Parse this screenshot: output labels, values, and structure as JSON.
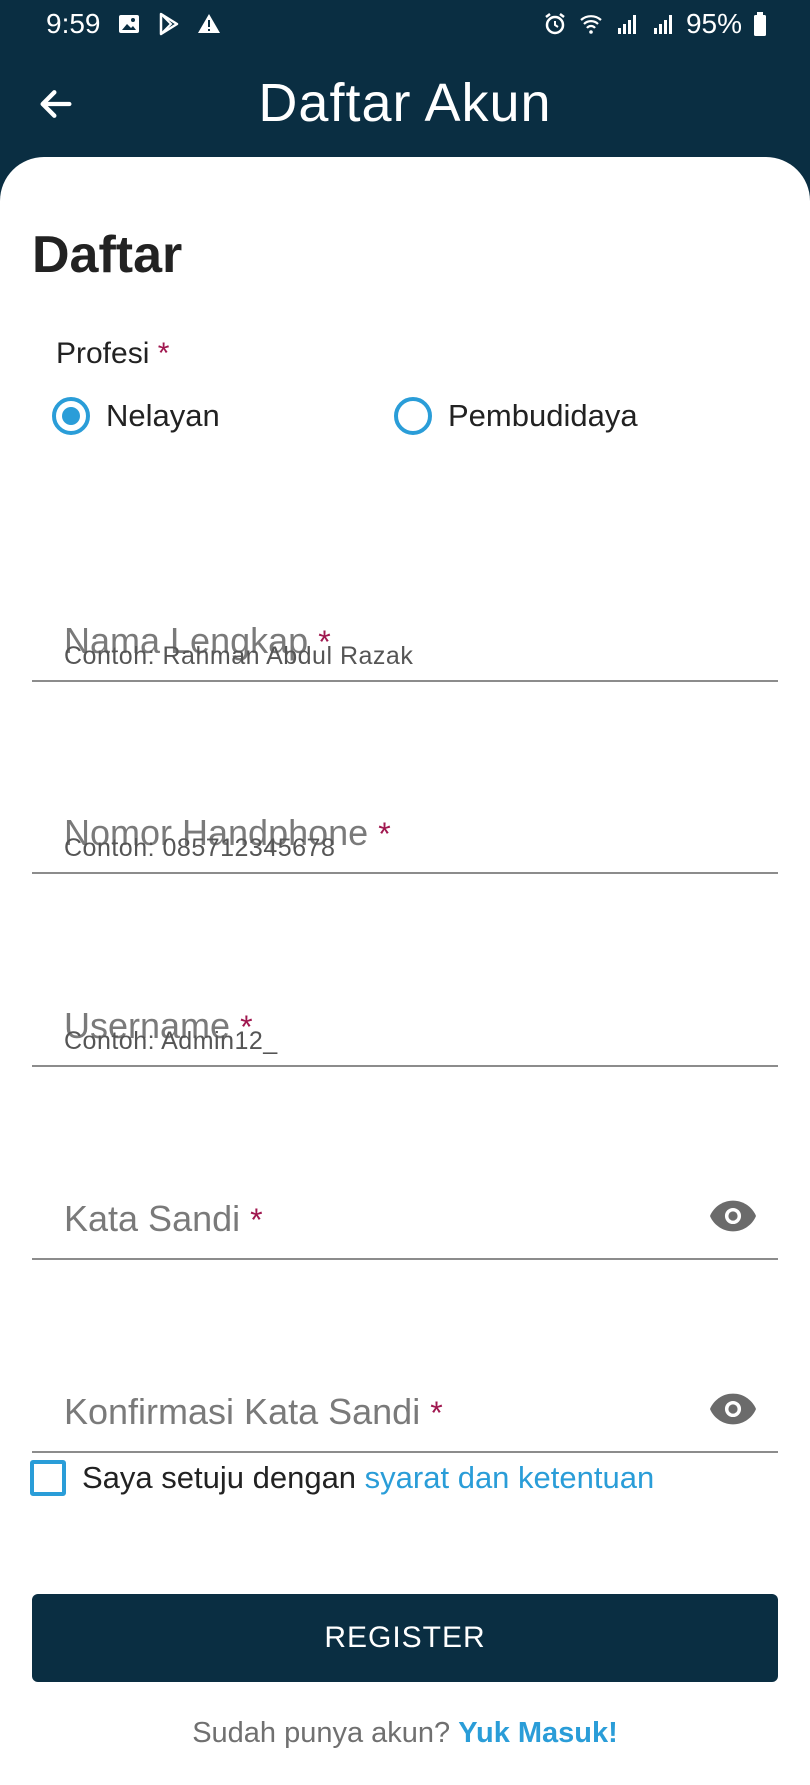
{
  "status_bar": {
    "time": "9:59",
    "battery": "95%",
    "icons_left": [
      "image-icon",
      "play-store-icon",
      "warning-icon"
    ],
    "icons_right": [
      "alarm-icon",
      "wifi-icon",
      "signal-icon",
      "signal-icon",
      "battery-icon"
    ]
  },
  "app_bar": {
    "title": "Daftar Akun",
    "back_icon": "arrow-left-icon"
  },
  "form": {
    "heading": "Daftar",
    "profesi": {
      "label": "Profesi",
      "required_mark": "*",
      "options": [
        {
          "label": "Nelayan",
          "selected": true
        },
        {
          "label": "Pembudidaya",
          "selected": false
        }
      ]
    },
    "fields": {
      "nama": {
        "label": "Nama Lengkap",
        "required_mark": "*",
        "helper": "Contoh: Rahman Abdul Razak",
        "value": ""
      },
      "phone": {
        "label": "Nomor Handphone",
        "required_mark": "*",
        "helper": "Contoh: 085712345678",
        "value": ""
      },
      "username": {
        "label": "Username",
        "required_mark": "*",
        "helper": "Contoh: Admin12_",
        "value": ""
      },
      "password": {
        "label": "Kata Sandi",
        "required_mark": "*",
        "value": "",
        "toggle_icon": "eye-icon"
      },
      "confirm": {
        "label": "Konfirmasi Kata Sandi",
        "required_mark": "*",
        "value": "",
        "toggle_icon": "eye-icon"
      }
    },
    "agreement": {
      "text": "Saya setuju dengan ",
      "link": "syarat dan ketentuan",
      "checked": false
    },
    "register_label": "REGISTER",
    "login_prompt": "Sudah punya akun? ",
    "login_link": "Yuk Masuk!"
  },
  "colors": {
    "primary_dark": "#0a2e42",
    "accent": "#2a9dd8",
    "required": "#a0174f"
  }
}
